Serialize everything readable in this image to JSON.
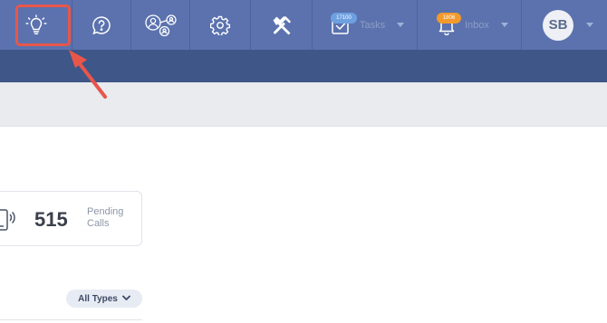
{
  "nav": {
    "tasks": {
      "label": "Tasks",
      "count": "17100"
    },
    "inbox": {
      "label": "Inbox",
      "count": "1806"
    },
    "profile": {
      "initials": "SB"
    }
  },
  "stats": {
    "pending_calls": {
      "value": "515",
      "label": "Pending Calls"
    }
  },
  "filter": {
    "selected": "All Types"
  },
  "colors": {
    "nav_bg": "#5b72ae",
    "subnav_bg": "#3f5688",
    "highlight": "#e8564a",
    "tasks_badge": "#6ea0e0",
    "inbox_badge": "#f39a2c"
  },
  "icons": {
    "ideas": "lightbulb-icon",
    "help": "question-bubble-icon",
    "users": "users-network-icon",
    "settings": "gear-icon",
    "tools": "tools-icon",
    "tasks": "tasks-checkbox-icon",
    "inbox": "bell-icon",
    "calls": "phone-icon",
    "filter": "chevron-down-icon"
  }
}
